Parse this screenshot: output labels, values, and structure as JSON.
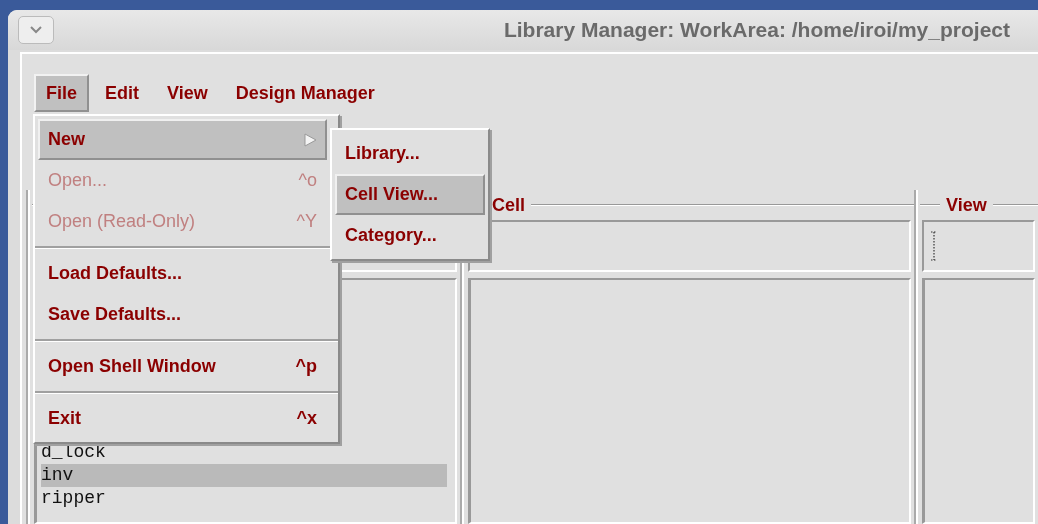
{
  "window": {
    "title": "Library Manager: WorkArea: /home/iroi/my_project"
  },
  "menu_bar": [
    {
      "label": "File",
      "selected": true
    },
    {
      "label": "Edit",
      "selected": false
    },
    {
      "label": "View",
      "selected": false
    },
    {
      "label": "Design Manager",
      "selected": false
    }
  ],
  "file_menu": {
    "items": [
      {
        "kind": "item",
        "label": "New",
        "submenu": true,
        "selected": true,
        "disabled": false
      },
      {
        "kind": "item",
        "label": "Open...",
        "shortcut": "^o",
        "selected": false,
        "disabled": true
      },
      {
        "kind": "item",
        "label": "Open (Read-Only)",
        "shortcut": "^Y",
        "selected": false,
        "disabled": true
      },
      {
        "kind": "separator"
      },
      {
        "kind": "item",
        "label": "Load Defaults...",
        "selected": false,
        "disabled": false
      },
      {
        "kind": "item",
        "label": "Save Defaults...",
        "selected": false,
        "disabled": false
      },
      {
        "kind": "separator"
      },
      {
        "kind": "item",
        "label": "Open Shell Window",
        "shortcut": "^p",
        "selected": false,
        "disabled": false
      },
      {
        "kind": "separator"
      },
      {
        "kind": "item",
        "label": "Exit",
        "shortcut": "^x",
        "selected": false,
        "disabled": false
      }
    ]
  },
  "new_submenu": {
    "items": [
      {
        "kind": "item",
        "label": "Library...",
        "selected": false,
        "disabled": false
      },
      {
        "kind": "item",
        "label": "Cell View...",
        "selected": true,
        "disabled": false
      },
      {
        "kind": "item",
        "label": "Category...",
        "selected": false,
        "disabled": false
      }
    ]
  },
  "columns": [
    {
      "kind": "library",
      "items": [
        {
          "label": "d_lock",
          "selected": false
        },
        {
          "label": "inv",
          "selected": true
        },
        {
          "label": "ripper",
          "selected": false
        }
      ]
    },
    {
      "kind": "cell",
      "title": "Cell"
    },
    {
      "kind": "view",
      "title": "View",
      "cursor": true
    }
  ]
}
